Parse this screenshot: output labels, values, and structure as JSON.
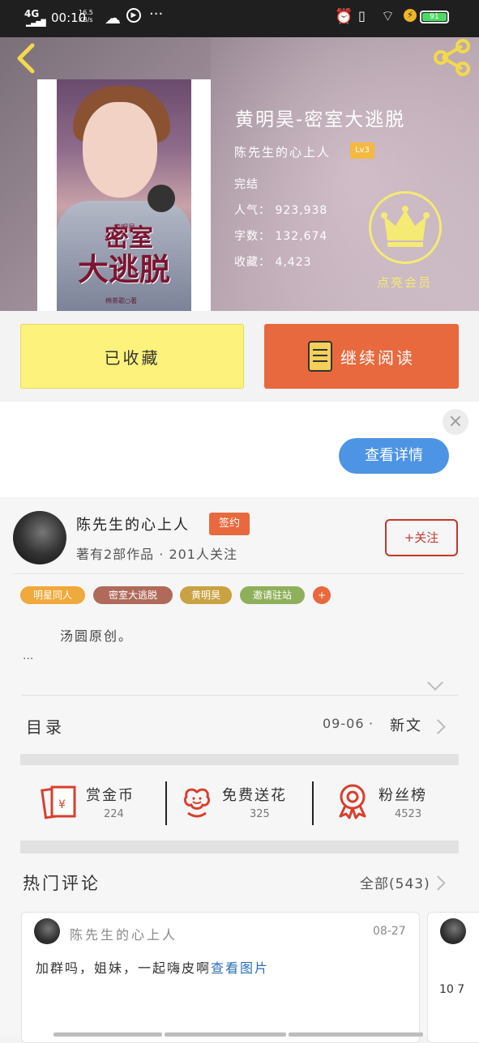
{
  "status_bar": {
    "network": "4G",
    "time": "00:10",
    "speed": "16.5\nKB/s",
    "dots": "···",
    "battery": "91"
  },
  "icons": {
    "back": "back-arrow-icon",
    "share": "share-icon",
    "crown": "crown-icon",
    "book": "book-icon"
  },
  "book": {
    "title": "黄明昊-密室大逃脱",
    "author": "陈先生的心上人",
    "level": "Lv3",
    "status": "完结",
    "popularity": "人气：  923,938",
    "words": "字数：  132,674",
    "collections": "收藏：  4,423",
    "cover_text_top": "黄明昊",
    "cover_text_1": "密室",
    "cover_text_2": "大逃脱",
    "cover_credit": "棉茶歌○著"
  },
  "vip_label": "点亮会员",
  "buttons": {
    "favorited": "已收藏",
    "continue_reading": "继续阅读"
  },
  "ad": {
    "close": "×",
    "detail_button": "查看详情"
  },
  "author_card": {
    "name": "陈先生的心上人",
    "badge": "签约",
    "stats": "著有2部作品 · 201人关注",
    "follow": "+关注"
  },
  "tags": [
    {
      "label": "明星同人",
      "color": "#f0a93c"
    },
    {
      "label": "密室大逃脱",
      "color": "#b06a5a"
    },
    {
      "label": "黄明昊",
      "color": "#c9a242"
    },
    {
      "label": "邀请驻站",
      "color": "#8fb05a"
    },
    {
      "label": "+",
      "color": "#e8693d"
    }
  ],
  "description": "汤圆原创。",
  "description_more": "...",
  "toc": {
    "label": "目录",
    "date": "09-06",
    "dot": "·",
    "new": "新文"
  },
  "stats": [
    {
      "label": "赏金币",
      "value": "224",
      "icon": "red-envelope-icon"
    },
    {
      "label": "免费送花",
      "value": "325",
      "icon": "flower-icon"
    },
    {
      "label": "粉丝榜",
      "value": "4523",
      "icon": "ribbon-badge-icon"
    }
  ],
  "comments_section": {
    "title": "热门评论",
    "all": "全部(543)"
  },
  "comments": [
    {
      "user": "陈先生的心上人",
      "date": "08-27",
      "text": "加群吗，姐妹，一起嗨皮啊",
      "link": "查看图片"
    }
  ],
  "partial_comment_text": "10 7"
}
